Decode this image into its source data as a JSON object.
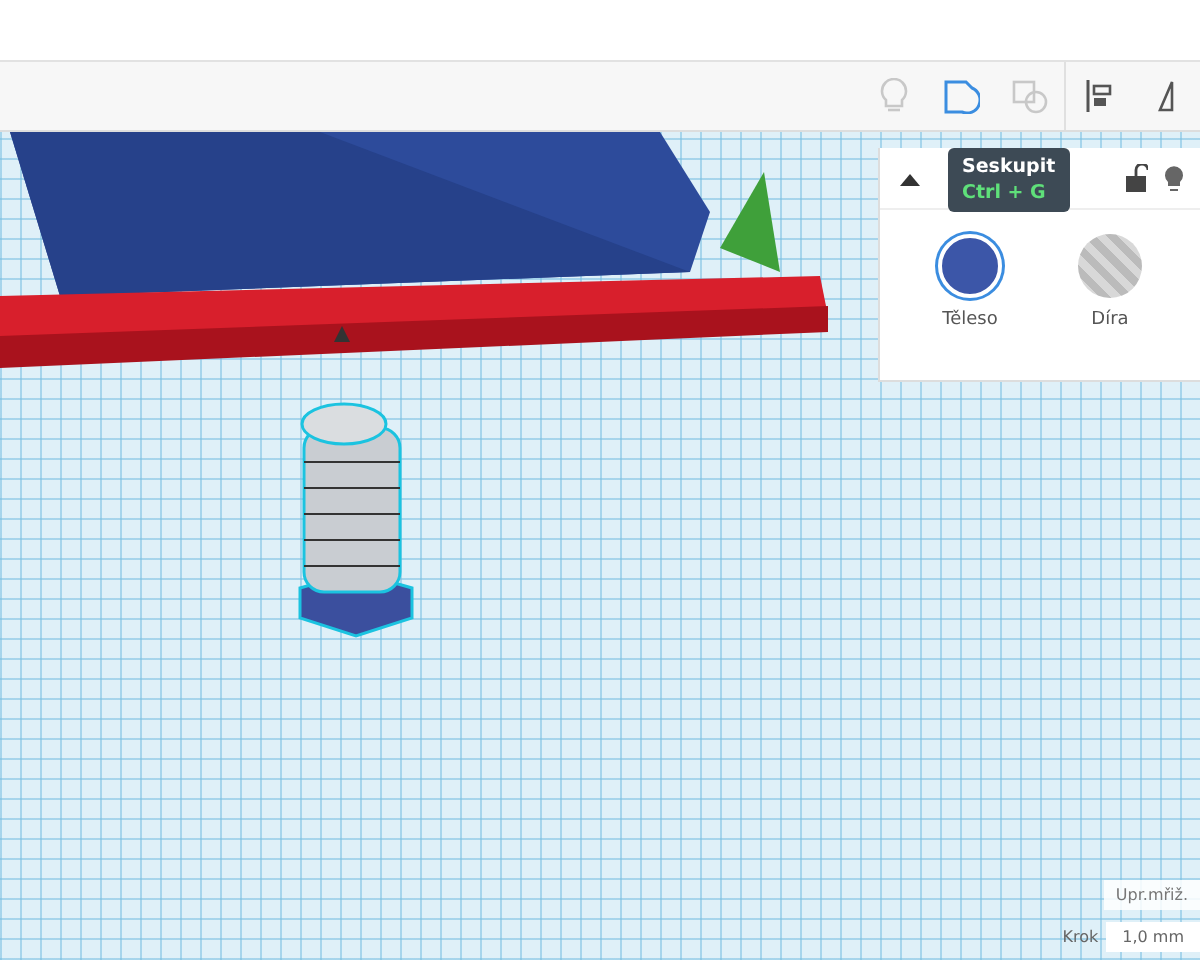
{
  "toolbar": {
    "buttons": [
      {
        "kind": "bulb",
        "disabled": true
      },
      {
        "kind": "group",
        "disabled": false
      },
      {
        "kind": "ungroup",
        "disabled": true
      },
      {
        "kind": "align",
        "disabled": false
      },
      {
        "kind": "mirror",
        "disabled": false
      }
    ]
  },
  "tooltip": {
    "title": "Seskupit",
    "shortcut": "Ctrl + G"
  },
  "inspector": {
    "expanded": true,
    "locked": false,
    "options": [
      {
        "kind": "solid",
        "label": "Těleso",
        "selected": true,
        "color": "#3c56a8"
      },
      {
        "kind": "hole",
        "label": "Díra",
        "selected": false
      }
    ]
  },
  "grid_controls": {
    "edit_grid": "Upr.mřiž.",
    "snap_label": "Krok",
    "snap_value": "1,0 mm"
  }
}
